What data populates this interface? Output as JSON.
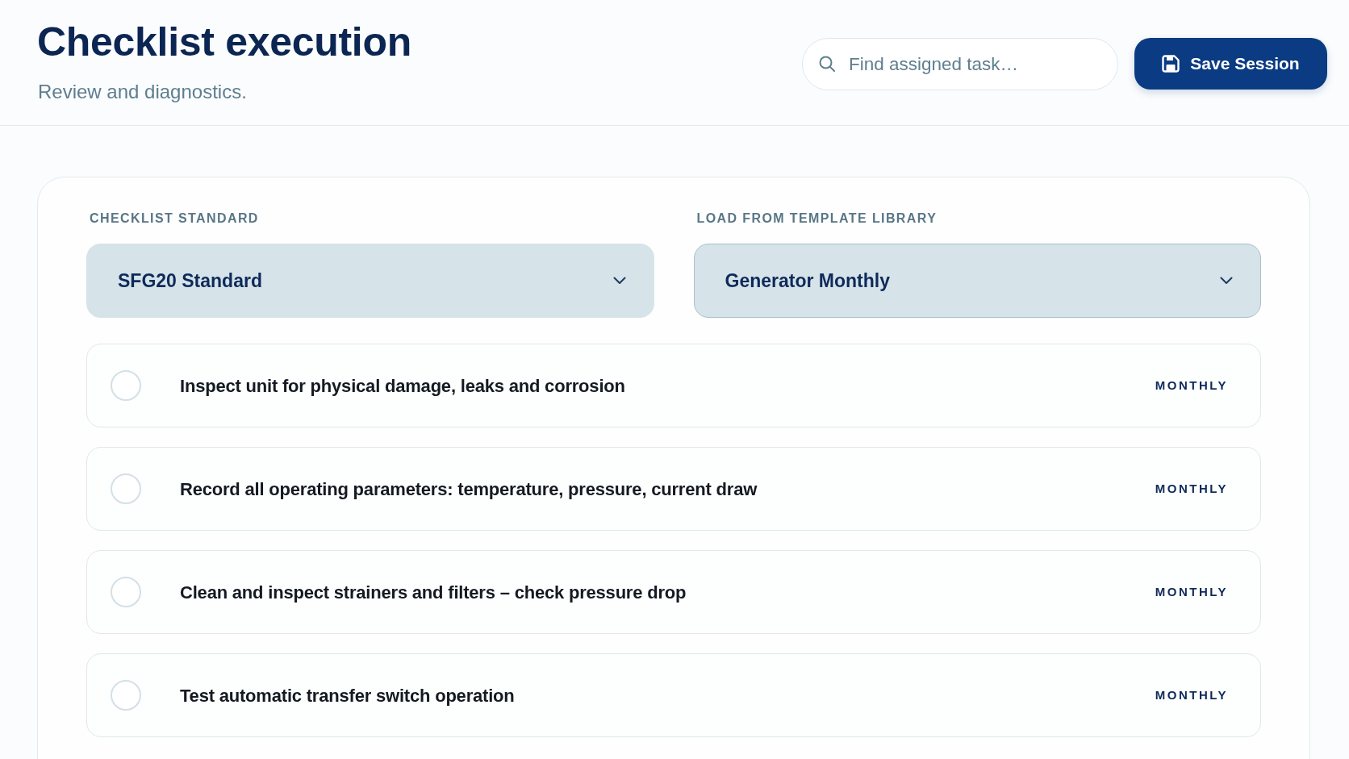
{
  "header": {
    "title": "Checklist execution",
    "subtitle": "Review and diagnostics.",
    "search": {
      "placeholder": "Find assigned task…"
    },
    "save_button": "Save Session"
  },
  "selectors": [
    {
      "label": "CHECKLIST STANDARD",
      "value": "SFG20 Standard",
      "focused": false
    },
    {
      "label": "LOAD FROM TEMPLATE LIBRARY",
      "value": "Generator Monthly",
      "focused": true
    }
  ],
  "tasks": [
    {
      "text": "Inspect unit for physical damage, leaks and corrosion",
      "frequency": "MONTHLY",
      "checked": false
    },
    {
      "text": "Record all operating parameters: temperature, pressure, current draw",
      "frequency": "MONTHLY",
      "checked": false
    },
    {
      "text": "Clean and inspect strainers and filters – check pressure drop",
      "frequency": "MONTHLY",
      "checked": false
    },
    {
      "text": "Test automatic transfer switch operation",
      "frequency": "MONTHLY",
      "checked": false
    }
  ]
}
